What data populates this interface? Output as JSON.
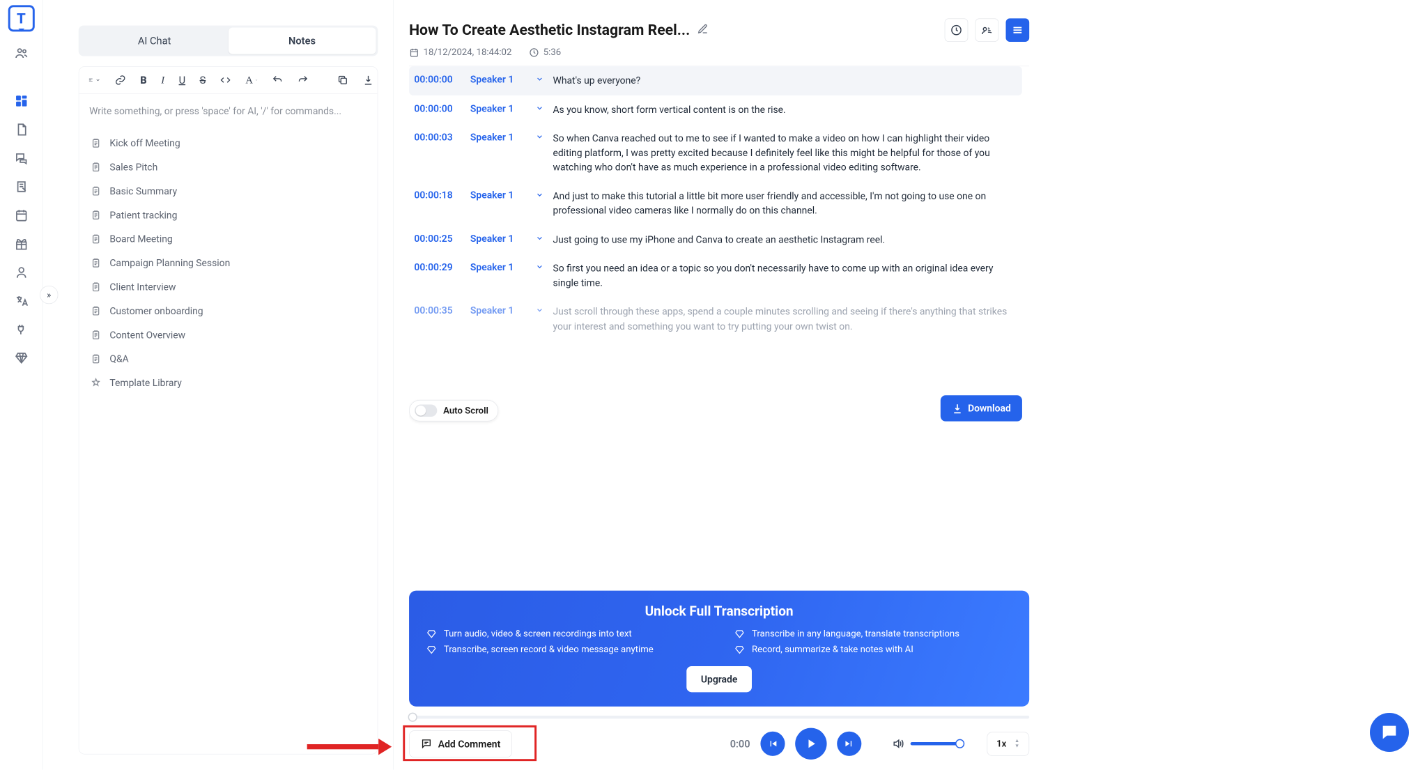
{
  "tabs": {
    "chat": "AI Chat",
    "notes": "Notes"
  },
  "editor": {
    "placeholder": "Write something, or press 'space' for AI, '/' for commands...",
    "templates": [
      "Kick off Meeting",
      "Sales Pitch",
      "Basic Summary",
      "Patient tracking",
      "Board Meeting",
      "Campaign Planning Session",
      "Client Interview",
      "Customer onboarding",
      "Content Overview",
      "Q&A",
      "Template Library"
    ]
  },
  "doc": {
    "title": "How To Create Aesthetic Instagram Reel...",
    "date": "18/12/2024, 18:44:02",
    "duration": "5:36"
  },
  "transcript": [
    {
      "t": "00:00:00",
      "s": "Speaker 1",
      "text": "What's up everyone?",
      "hl": true
    },
    {
      "t": "00:00:00",
      "s": "Speaker 1",
      "text": "As you know, short form vertical content is on the rise."
    },
    {
      "t": "00:00:03",
      "s": "Speaker 1",
      "text": "So when Canva reached out to me to see if I wanted to make a video on how I can highlight their video editing platform, I was pretty excited because I definitely feel like this might be helpful for those of you watching who don't have as much experience in a professional video editing software."
    },
    {
      "t": "00:00:18",
      "s": "Speaker 1",
      "text": "And just to make this tutorial a little bit more user friendly and accessible, I'm not going to use one on professional video cameras like I normally do on this channel."
    },
    {
      "t": "00:00:25",
      "s": "Speaker 1",
      "text": "Just going to use my iPhone and Canva to create an aesthetic Instagram reel."
    },
    {
      "t": "00:00:29",
      "s": "Speaker 1",
      "text": "So first you need an idea or a topic so you don't necessarily have to come up with an original idea every single time."
    },
    {
      "t": "00:00:35",
      "s": "Speaker 1",
      "text": "Just scroll through these apps, spend a couple minutes scrolling and seeing if there's anything that strikes your interest and something you want to try putting your own twist on.",
      "faded": true
    }
  ],
  "autoscroll": "Auto Scroll",
  "download": "Download",
  "banner": {
    "title": "Unlock Full Transcription",
    "items": [
      "Turn audio, video & screen recordings into text",
      "Transcribe in any language, translate transcriptions",
      "Transcribe, screen record & video message anytime",
      "Record, summarize & take notes with AI"
    ],
    "cta": "Upgrade"
  },
  "player": {
    "time": "0:00",
    "speed": "1x",
    "addComment": "Add Comment"
  }
}
